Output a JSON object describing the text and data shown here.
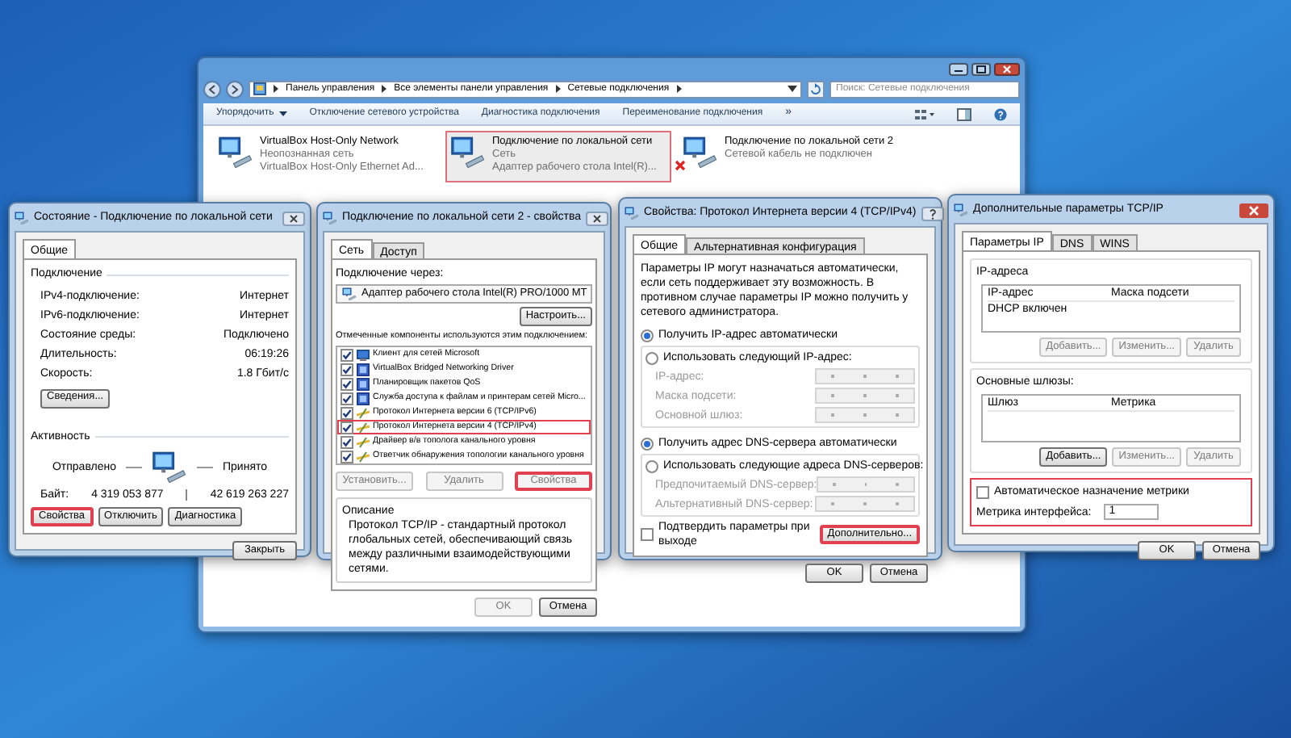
{
  "explorer": {
    "address": [
      "Панель управления",
      "Все элементы панели управления",
      "Сетевые подключения"
    ],
    "search_placeholder": "Поиск: Сетевые подключения",
    "toolbar": [
      {
        "label": "Упорядочить",
        "dropdown": true
      },
      {
        "label": "Отключение сетевого устройства",
        "dropdown": false
      },
      {
        "label": "Диагностика подключения",
        "dropdown": false
      },
      {
        "label": "Переименование подключения",
        "dropdown": false
      }
    ],
    "overflow": "»",
    "connections": [
      {
        "name": "VirtualBox Host-Only Network",
        "status": "Неопознанная сеть",
        "adapter": "VirtualBox Host-Only Ethernet Ad...",
        "selected": false,
        "highlighted": false,
        "disconnected": false
      },
      {
        "name": "Подключение по локальной сети",
        "status": "Сеть",
        "adapter": "Адаптер рабочего стола Intel(R)...",
        "selected": true,
        "highlighted": true,
        "disconnected": false
      },
      {
        "name": "Подключение по локальной сети 2",
        "status": "Сетевой кабель не подключен",
        "selected": false,
        "highlighted": false,
        "disconnected": true
      }
    ]
  },
  "status_dialog": {
    "title": "Состояние - Подключение по локальной сети",
    "tabs": [
      {
        "label": "Общие",
        "selected": true
      }
    ],
    "connection_heading": "Подключение",
    "rows": [
      {
        "label": "IPv4-подключение:",
        "value": "Интернет"
      },
      {
        "label": "IPv6-подключение:",
        "value": "Интернет"
      },
      {
        "label": "Состояние среды:",
        "value": "Подключено"
      },
      {
        "label": "Длительность:",
        "value": "06:19:26"
      },
      {
        "label": "Скорость:",
        "value": "1.8 Гбит/с"
      }
    ],
    "details_button": {
      "label": "Сведения...",
      "disabled": false,
      "highlighted": false
    },
    "activity_heading": "Активность",
    "sent_label": "Отправлено",
    "received_label": "Принято",
    "bytes_label": "Байт:",
    "bytes_sent": "4 319 053 877",
    "bytes_received": "42 619 263 227",
    "buttons": [
      {
        "label": "Свойства",
        "disabled": false,
        "highlighted": true
      },
      {
        "label": "Отключить",
        "disabled": false,
        "highlighted": false
      },
      {
        "label": "Диагностика",
        "disabled": false,
        "highlighted": false
      }
    ],
    "close_button": {
      "label": "Закрыть",
      "disabled": false,
      "highlighted": false
    }
  },
  "properties_dialog": {
    "title": "Подключение по локальной сети 2 - свойства",
    "tabs": [
      {
        "label": "Сеть",
        "selected": true
      },
      {
        "label": "Доступ",
        "selected": false
      }
    ],
    "connect_using_label": "Подключение через:",
    "adapter": "Адаптер рабочего стола Intel(R) PRO/1000 MT",
    "configure_button": {
      "label": "Настроить...",
      "disabled": false,
      "highlighted": false
    },
    "components_label": "Отмеченные компоненты используются этим подключением:",
    "components": [
      {
        "label": "Клиент для сетей Microsoft",
        "kind": "client",
        "checked": true,
        "highlighted": false
      },
      {
        "label": "VirtualBox Bridged Networking Driver",
        "kind": "service",
        "checked": true,
        "highlighted": false
      },
      {
        "label": "Планировщик пакетов QoS",
        "kind": "service",
        "checked": true,
        "highlighted": false
      },
      {
        "label": "Служба доступа к файлам и принтерам сетей Micro...",
        "kind": "service",
        "checked": true,
        "highlighted": false
      },
      {
        "label": "Протокол Интернета версии 6 (TCP/IPv6)",
        "kind": "protocol",
        "checked": true,
        "highlighted": false
      },
      {
        "label": "Протокол Интернета версии 4 (TCP/IPv4)",
        "kind": "protocol",
        "checked": true,
        "highlighted": true
      },
      {
        "label": "Драйвер в/в тополога канального уровня",
        "kind": "protocol",
        "checked": true,
        "highlighted": false
      },
      {
        "label": "Ответчик обнаружения топологии канального уровня",
        "kind": "protocol",
        "checked": true,
        "highlighted": false
      }
    ],
    "component_buttons": [
      {
        "label": "Установить...",
        "disabled": true,
        "highlighted": false
      },
      {
        "label": "Удалить",
        "disabled": true,
        "highlighted": false
      },
      {
        "label": "Свойства",
        "disabled": true,
        "highlighted": true
      }
    ],
    "description_heading": "Описание",
    "description": "Протокол TCP/IP - стандартный протокол глобальных сетей, обеспечивающий связь между различными взаимодействующими сетями.",
    "buttons": [
      {
        "label": "OK",
        "disabled": true,
        "highlighted": false
      },
      {
        "label": "Отмена",
        "disabled": false,
        "highlighted": false
      }
    ]
  },
  "ipv4_dialog": {
    "title": "Свойства: Протокол Интернета версии 4 (TCP/IPv4)",
    "tabs": [
      {
        "label": "Общие",
        "selected": true
      },
      {
        "label": "Альтернативная конфигурация",
        "selected": false
      }
    ],
    "intro": "Параметры IP могут назначаться автоматически, если сеть поддерживает эту возможность. В противном случае параметры IP можно получить у сетевого администратора.",
    "ip_options": [
      {
        "label": "Получить IP-адрес автоматически",
        "selected": true
      },
      {
        "label": "Использовать следующий IP-адрес:",
        "selected": false
      }
    ],
    "ip_fields": [
      {
        "label": "IP-адрес:"
      },
      {
        "label": "Маска подсети:"
      },
      {
        "label": "Основной шлюз:"
      }
    ],
    "dns_options": [
      {
        "label": "Получить адрес DNS-сервера автоматически",
        "selected": true
      },
      {
        "label": "Использовать следующие адреса DNS-серверов:",
        "selected": false
      }
    ],
    "dns_fields": [
      {
        "label": "Предпочитаемый DNS-сервер:"
      },
      {
        "label": "Альтернативный DNS-сервер:"
      }
    ],
    "validate_checkbox": {
      "label": "Подтвердить параметры при выходе",
      "checked": false
    },
    "advanced_button": {
      "label": "Дополнительно...",
      "disabled": false,
      "highlighted": true
    },
    "buttons": [
      {
        "label": "OK",
        "disabled": false,
        "highlighted": false
      },
      {
        "label": "Отмена",
        "disabled": false,
        "highlighted": false
      }
    ]
  },
  "advanced_dialog": {
    "title": "Дополнительные параметры TCP/IP",
    "tabs": [
      {
        "label": "Параметры IP",
        "selected": true
      },
      {
        "label": "DNS",
        "selected": false
      },
      {
        "label": "WINS",
        "selected": false
      }
    ],
    "ip_group": {
      "heading": "IP-адреса",
      "columns": [
        "IP-адрес",
        "Маска подсети"
      ],
      "rows": [
        [
          "DHCP включен"
        ]
      ],
      "buttons": [
        {
          "label": "Добавить...",
          "disabled": true,
          "highlighted": false
        },
        {
          "label": "Изменить...",
          "disabled": true,
          "highlighted": false
        },
        {
          "label": "Удалить",
          "disabled": true,
          "highlighted": false
        }
      ]
    },
    "gateway_group": {
      "heading": "Основные шлюзы:",
      "columns": [
        "Шлюз",
        "Метрика"
      ],
      "buttons": [
        {
          "label": "Добавить...",
          "disabled": false,
          "highlighted": false
        },
        {
          "label": "Изменить...",
          "disabled": true,
          "highlighted": false
        },
        {
          "label": "Удалить",
          "disabled": true,
          "highlighted": false
        }
      ]
    },
    "auto_metric": {
      "label": "Автоматическое назначение метрики",
      "checked": false
    },
    "metric_label": "Метрика интерфейса:",
    "metric_value": "1",
    "metric_highlighted": true,
    "buttons": [
      {
        "label": "OK",
        "disabled": false,
        "highlighted": false
      },
      {
        "label": "Отмена",
        "disabled": false,
        "highlighted": false
      }
    ]
  }
}
